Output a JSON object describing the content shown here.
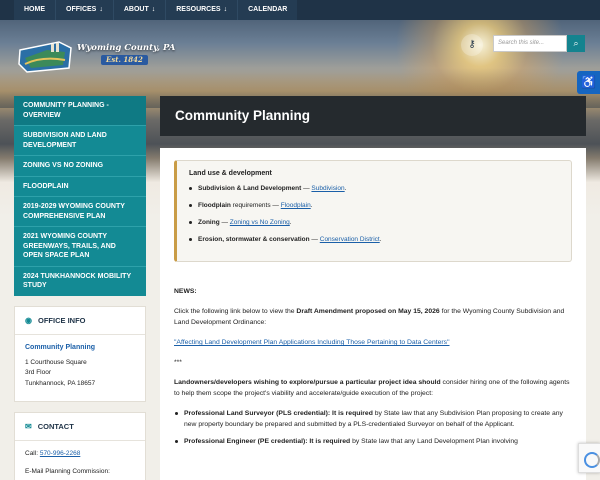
{
  "nav": {
    "items": [
      {
        "label": "HOME",
        "caret": ""
      },
      {
        "label": "OFFICES",
        "caret": "↓"
      },
      {
        "label": "ABOUT",
        "caret": "↓"
      },
      {
        "label": "RESOURCES",
        "caret": "↓"
      },
      {
        "label": "CALENDAR",
        "caret": ""
      }
    ]
  },
  "logo": {
    "title": "Wyoming County, PA",
    "est": "Est. 1842"
  },
  "search": {
    "placeholder": "Search this site..."
  },
  "sidebar": {
    "items": [
      {
        "label": "COMMUNITY PLANNING - OVERVIEW"
      },
      {
        "label": "SUBDIVISION AND LAND DEVELOPMENT"
      },
      {
        "label": "ZONING VS NO ZONING"
      },
      {
        "label": "FLOODPLAIN"
      },
      {
        "label": "2019-2029 WYOMING COUNTY COMPREHENSIVE PLAN"
      },
      {
        "label": "2021 WYOMING COUNTY GREENWAYS, TRAILS, AND OPEN SPACE PLAN"
      },
      {
        "label": "2024 TUNKHANNOCK MOBILITY STUDY"
      }
    ]
  },
  "office_info": {
    "heading": "OFFICE INFO",
    "name": "Community Planning",
    "address1": "1 Courthouse Square",
    "address2": "3rd Floor",
    "address3": "Tunkhannock, PA 18657"
  },
  "contact": {
    "heading": "CONTACT",
    "call_label": "Call:",
    "phone": "570-996-2268",
    "email_label": "E-Mail Planning Commission:"
  },
  "page": {
    "title": "Community Planning"
  },
  "callout": {
    "heading": "Land use & development",
    "items": [
      {
        "bold": "Subdivision & Land Development",
        "text": " — ",
        "link": "Subdivision",
        "tail": "."
      },
      {
        "bold": "Floodplain",
        "text": " requirements — ",
        "link": "Floodplain",
        "tail": "."
      },
      {
        "bold": "Zoning",
        "text": " — ",
        "link": "Zoning vs No Zoning",
        "tail": "."
      },
      {
        "bold": "Erosion, stormwater & conservation",
        "text": " — ",
        "link": "Conservation District",
        "tail": "."
      }
    ]
  },
  "news": {
    "label": "NEWS:",
    "p1_pre": "Click the following link below to view the ",
    "p1_bold": "Draft Amendment proposed on May 15, 2026",
    "p1_post": " for the Wyoming County Subdivision and Land Development Ordinance:",
    "link": "\"Affecting Land Development Plan Applications Including Those Pertaining to Data Centers\"",
    "separator": "***",
    "p2_bold": "Landowners/developers wishing to explore/pursue a particular project idea should",
    "p2_post": " consider hiring one of the following agents to help them scope the project's viability and accelerate/guide execution of the project:",
    "bullets": [
      {
        "bold": "Professional Land Surveyor (PLS credential): It is required",
        "text": " by State law that any Subdivision Plan proposing to create any new property boundary be prepared and submitted by a PLS-credentialed Surveyor on behalf of the Applicant."
      },
      {
        "bold": "Professional Engineer (PE credential): It is required",
        "text": " by State law that any Land Development Plan involving"
      }
    ]
  },
  "colors": {
    "nav_bg": "#1f3347",
    "teal": "#138a94",
    "title_bar": "#252a2e",
    "accent_border": "#c99c46",
    "link": "#1a5fa8"
  }
}
